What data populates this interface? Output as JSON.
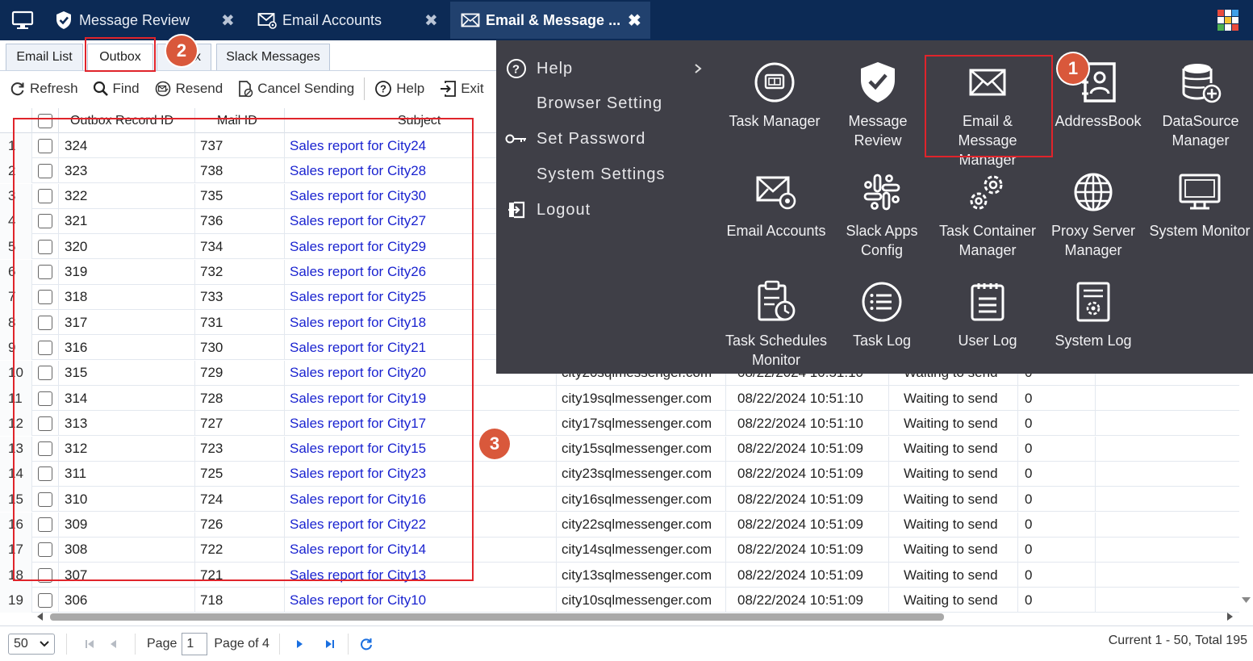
{
  "app_tabs": [
    {
      "label": "Message Review",
      "icon": "shield-check-icon",
      "active": false
    },
    {
      "label": "Email Accounts",
      "icon": "email-gear-icon",
      "active": false
    },
    {
      "label": "Email & Message ...",
      "icon": "envelope-icon",
      "active": true
    }
  ],
  "sub_tabs": [
    {
      "label": "Email List"
    },
    {
      "label": "Outbox"
    },
    {
      "label": "x"
    },
    {
      "label": "Slack Messages"
    }
  ],
  "toolbar": {
    "refresh": "Refresh",
    "find": "Find",
    "resend": "Resend",
    "cancel": "Cancel Sending",
    "help": "Help",
    "exit": "Exit"
  },
  "grid": {
    "headers": {
      "record_id": "Outbox Record ID",
      "mail_id": "Mail ID",
      "subject": "Subject"
    },
    "rows": [
      {
        "n": "1",
        "rid": "324",
        "mid": "737",
        "subject": "Sales report for City24",
        "to": "",
        "date": "",
        "status": "",
        "count": ""
      },
      {
        "n": "2",
        "rid": "323",
        "mid": "738",
        "subject": "Sales report for City28",
        "to": "",
        "date": "",
        "status": "",
        "count": ""
      },
      {
        "n": "3",
        "rid": "322",
        "mid": "735",
        "subject": "Sales report for City30",
        "to": "",
        "date": "",
        "status": "",
        "count": ""
      },
      {
        "n": "4",
        "rid": "321",
        "mid": "736",
        "subject": "Sales report for City27",
        "to": "",
        "date": "",
        "status": "",
        "count": ""
      },
      {
        "n": "5",
        "rid": "320",
        "mid": "734",
        "subject": "Sales report for City29",
        "to": "",
        "date": "",
        "status": "",
        "count": ""
      },
      {
        "n": "6",
        "rid": "319",
        "mid": "732",
        "subject": "Sales report for City26",
        "to": "",
        "date": "",
        "status": "",
        "count": ""
      },
      {
        "n": "7",
        "rid": "318",
        "mid": "733",
        "subject": "Sales report for City25",
        "to": "",
        "date": "",
        "status": "",
        "count": ""
      },
      {
        "n": "8",
        "rid": "317",
        "mid": "731",
        "subject": "Sales report for City18",
        "to": "",
        "date": "",
        "status": "",
        "count": ""
      },
      {
        "n": "9",
        "rid": "316",
        "mid": "730",
        "subject": "Sales report for City21",
        "to": "",
        "date": "",
        "status": "",
        "count": ""
      },
      {
        "n": "10",
        "rid": "315",
        "mid": "729",
        "subject": "Sales report for City20",
        "to": "city20sqlmessenger.com",
        "date": "08/22/2024 10:51:10",
        "status": "Waiting to send",
        "count": "0"
      },
      {
        "n": "11",
        "rid": "314",
        "mid": "728",
        "subject": "Sales report for City19",
        "to": "city19sqlmessenger.com",
        "date": "08/22/2024 10:51:10",
        "status": "Waiting to send",
        "count": "0"
      },
      {
        "n": "12",
        "rid": "313",
        "mid": "727",
        "subject": "Sales report for City17",
        "to": "city17sqlmessenger.com",
        "date": "08/22/2024 10:51:10",
        "status": "Waiting to send",
        "count": "0"
      },
      {
        "n": "13",
        "rid": "312",
        "mid": "723",
        "subject": "Sales report for City15",
        "to": "city15sqlmessenger.com",
        "date": "08/22/2024 10:51:09",
        "status": "Waiting to send",
        "count": "0"
      },
      {
        "n": "14",
        "rid": "311",
        "mid": "725",
        "subject": "Sales report for City23",
        "to": "city23sqlmessenger.com",
        "date": "08/22/2024 10:51:09",
        "status": "Waiting to send",
        "count": "0"
      },
      {
        "n": "15",
        "rid": "310",
        "mid": "724",
        "subject": "Sales report for City16",
        "to": "city16sqlmessenger.com",
        "date": "08/22/2024 10:51:09",
        "status": "Waiting to send",
        "count": "0"
      },
      {
        "n": "16",
        "rid": "309",
        "mid": "726",
        "subject": "Sales report for City22",
        "to": "city22sqlmessenger.com",
        "date": "08/22/2024 10:51:09",
        "status": "Waiting to send",
        "count": "0"
      },
      {
        "n": "17",
        "rid": "308",
        "mid": "722",
        "subject": "Sales report for City14",
        "to": "city14sqlmessenger.com",
        "date": "08/22/2024 10:51:09",
        "status": "Waiting to send",
        "count": "0"
      },
      {
        "n": "18",
        "rid": "307",
        "mid": "721",
        "subject": "Sales report for City13",
        "to": "city13sqlmessenger.com",
        "date": "08/22/2024 10:51:09",
        "status": "Waiting to send",
        "count": "0"
      },
      {
        "n": "19",
        "rid": "306",
        "mid": "718",
        "subject": "Sales report for City10",
        "to": "city10sqlmessenger.com",
        "date": "08/22/2024 10:51:09",
        "status": "Waiting to send",
        "count": "0"
      }
    ]
  },
  "pager": {
    "page_size": "50",
    "page_label": "Page",
    "page_value": "1",
    "page_of": "Page of 4",
    "info": "Current 1 - 50, Total 195"
  },
  "menu": {
    "items": [
      {
        "label": "Help",
        "icon": "help-circle-icon"
      },
      {
        "label": "Browser Setting",
        "icon": ""
      },
      {
        "label": "Set Password",
        "icon": "key-icon"
      },
      {
        "label": "System Settings",
        "icon": ""
      },
      {
        "label": "Logout",
        "icon": "logout-icon"
      }
    ],
    "launchers": [
      {
        "label": "Task Manager",
        "icon": "task-manager-icon"
      },
      {
        "label": "Message Review",
        "icon": "shield-check-icon"
      },
      {
        "label": "Email & Message Manager",
        "icon": "envelope-icon"
      },
      {
        "label": "AddressBook",
        "icon": "address-book-icon"
      },
      {
        "label": "DataSource Manager",
        "icon": "database-add-icon"
      },
      {
        "label": "Email Accounts",
        "icon": "email-gear-icon"
      },
      {
        "label": "Slack Apps Config",
        "icon": "slack-icon"
      },
      {
        "label": "Task Container Manager",
        "icon": "gears-icon"
      },
      {
        "label": "Proxy Server Manager",
        "icon": "globe-icon"
      },
      {
        "label": "System Monitor",
        "icon": "monitor-icon"
      },
      {
        "label": "Task Schedules Monitor",
        "icon": "clipboard-clock-icon"
      },
      {
        "label": "Task Log",
        "icon": "list-circle-icon"
      },
      {
        "label": "User Log",
        "icon": "clipboard-list-icon"
      },
      {
        "label": "System Log",
        "icon": "document-gear-icon"
      }
    ]
  },
  "annotations": {
    "badge1": "1",
    "badge2": "2",
    "badge3": "3"
  },
  "colors": {
    "titlebar": "#0c2a55",
    "menu_bg": "#3f3f47",
    "link": "#1a23d0",
    "annotation_red": "#e0242b",
    "badge": "#d9583b"
  }
}
